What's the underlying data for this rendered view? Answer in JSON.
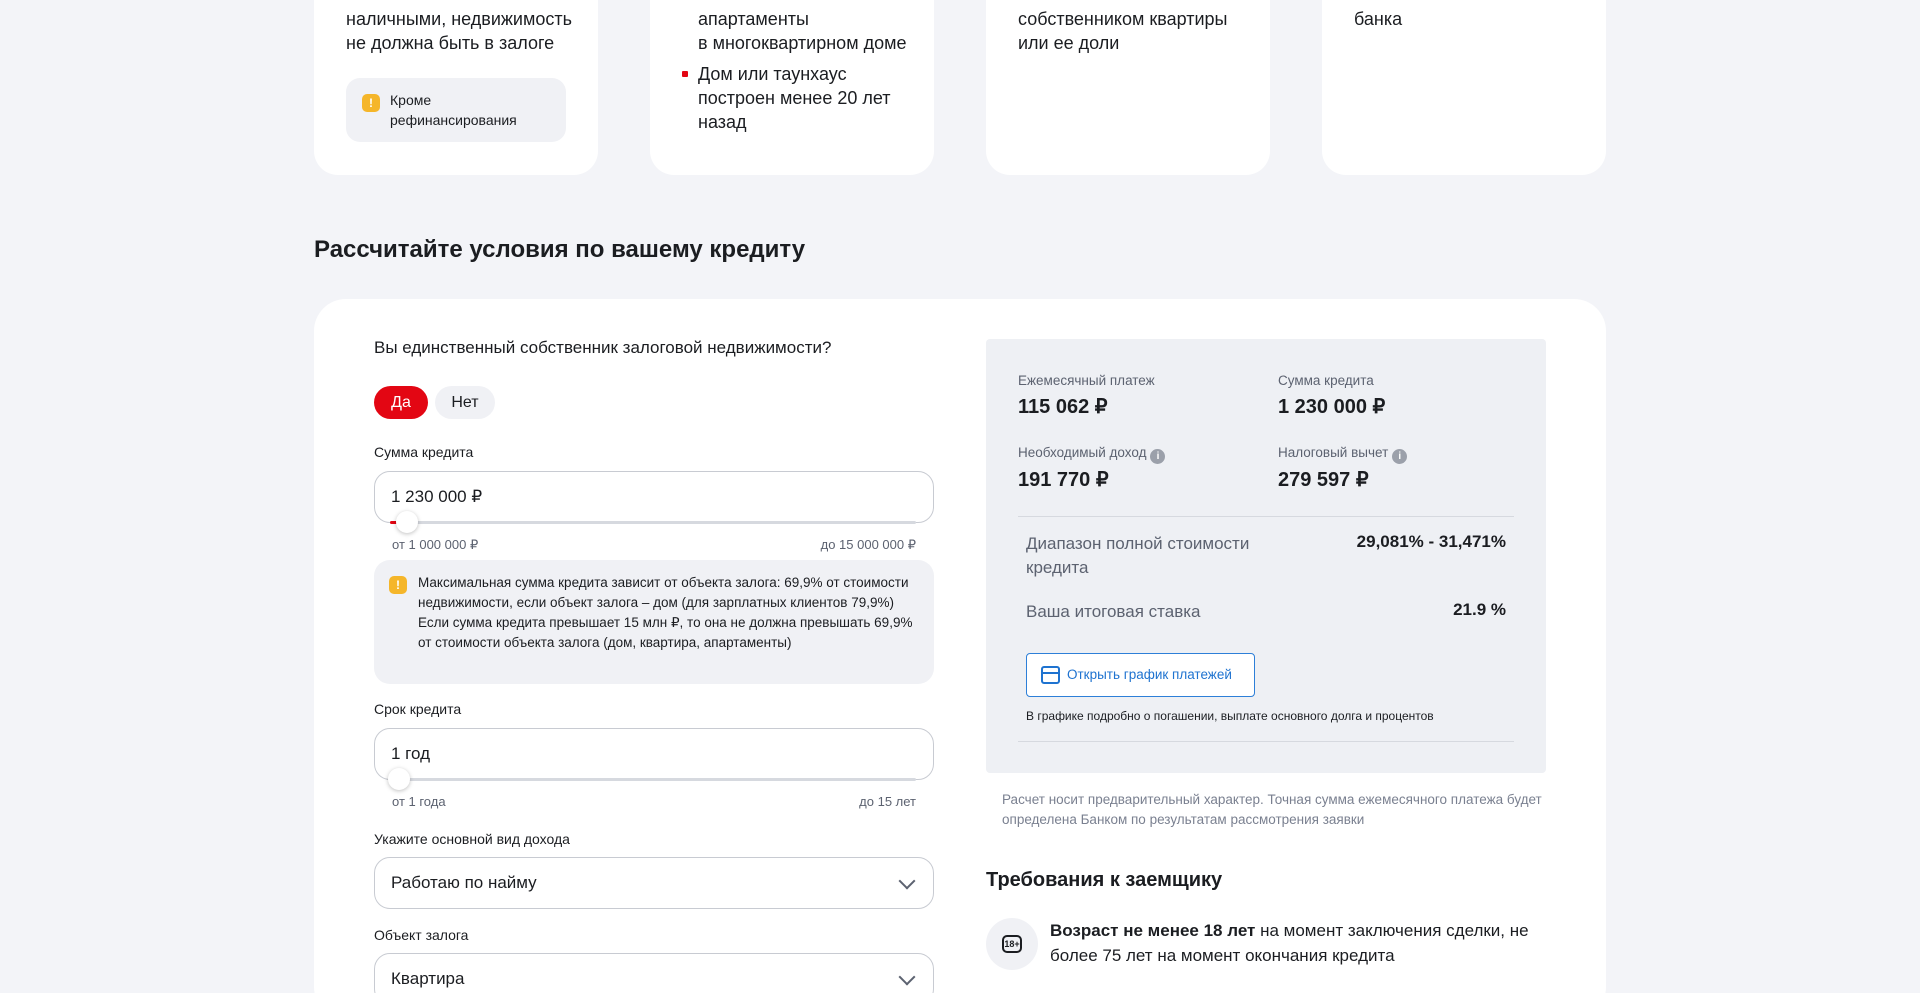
{
  "top_cards": [
    {
      "lines": [
        "наличными, недвижимость",
        "не должна быть в залоге"
      ],
      "note": "Кроме рефинансирования"
    },
    {
      "lines": [
        "апартаменты",
        "в многоквартирном доме"
      ],
      "bullet": "Дом или таунхаус построен менее 20 лет назад"
    },
    {
      "lines": [
        "собственником квартиры",
        "или ее доли"
      ]
    },
    {
      "lines": [
        "банка"
      ]
    }
  ],
  "section_title": "Рассчитайте условия по вашему кредиту",
  "form": {
    "owner_question": "Вы единственный собственник залоговой недвижимости?",
    "owner_yes": "Да",
    "owner_no": "Нет",
    "amount_label": "Сумма кредита",
    "amount_value": "1 230 000 ₽",
    "amount_min": "от 1 000 000 ₽",
    "amount_max": "до 15 000 000 ₽",
    "amount_progress": 0.016,
    "amount_note": "Максимальная сумма кредита зависит от объекта залога: 69,9% от стоимости недвижимости, если объект залога – дом (для зарплатных клиентов 79,9%) Если сумма кредита превышает 15 млн ₽, то она не должна превышать 69,9% от стоимости объекта залога (дом, квартира, апартаменты)",
    "term_label": "Срок кредита",
    "term_value": "1 год",
    "term_min": "от 1 года",
    "term_max": "до 15 лет",
    "term_progress": 0,
    "income_label": "Укажите основной вид дохода",
    "income_value": "Работаю по найму",
    "collateral_label": "Объект залога",
    "collateral_value": "Квартира"
  },
  "result": {
    "monthly_label": "Ежемесячный платеж",
    "monthly_value": "115 062 ₽",
    "sum_label": "Сумма кредита",
    "sum_value": "1 230 000 ₽",
    "income_label": "Необходимый доход",
    "income_value": "191 770 ₽",
    "tax_label": "Налоговый вычет",
    "tax_value": "279 597 ₽",
    "full_cost_label": "Диапазон полной стоимости кредита",
    "full_cost_value": "29,081% - 31,471%",
    "rate_label": "Ваша итоговая ставка",
    "rate_value": "21.9 %",
    "schedule_button": "Открыть график платежей",
    "schedule_note": "В графике подробно о погашении, выплате основного долга и процентов",
    "disclaimer": "Расчет носит предварительный характер. Точная сумма ежемесячного платежа будет определена Банком по результатам рассмотрения заявки"
  },
  "requirements": {
    "title": "Требования к заемщику",
    "age_badge": "18+",
    "age_bold": "Возраст не менее 18 лет",
    "age_rest": " на момент заключения сделки, не более 75 лет на момент окончания кредита"
  },
  "colors": {
    "accent": "#e30613",
    "link": "#1f73d0",
    "warning": "#f5b62a",
    "background": "#f3f4f8"
  },
  "icons": [
    "warning-icon",
    "info-icon",
    "calendar-icon",
    "chevron-down-icon",
    "age-18-icon"
  ]
}
